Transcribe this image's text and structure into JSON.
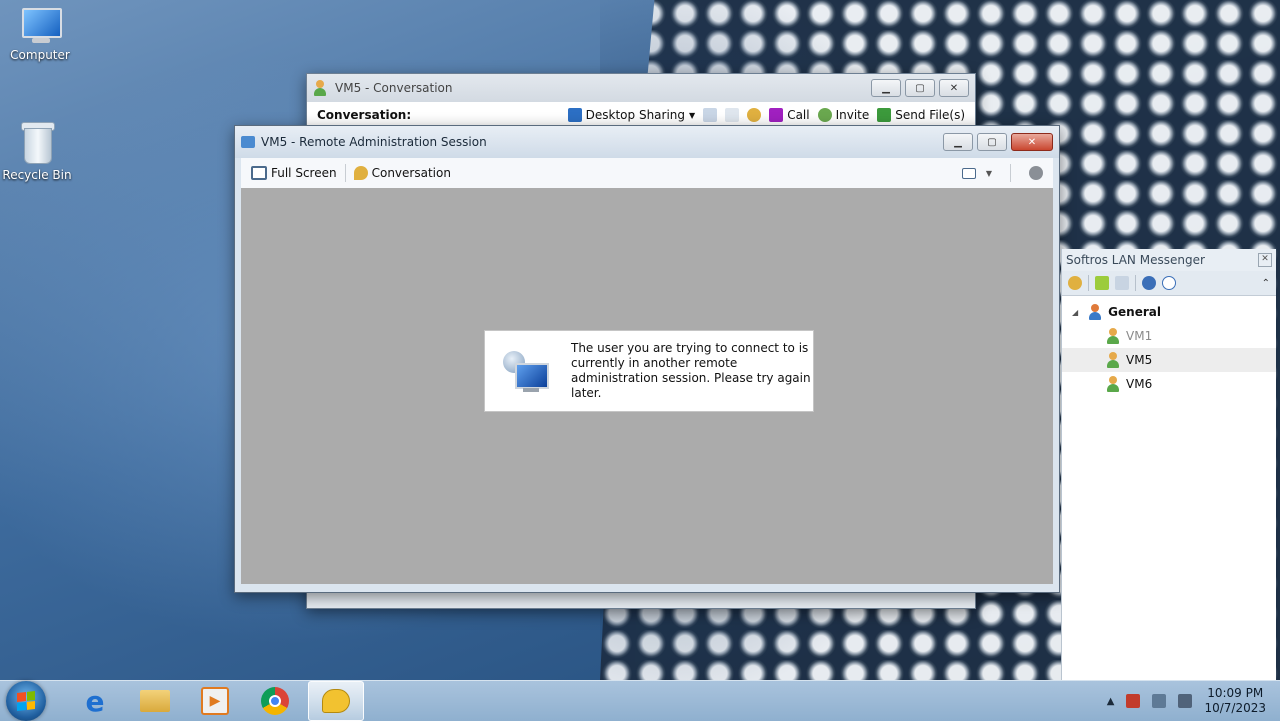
{
  "desktop": {
    "icons": [
      {
        "label": "Computer"
      },
      {
        "label": "Recycle Bin"
      }
    ]
  },
  "conversation_window": {
    "title": "VM5 - Conversation",
    "conversation_label": "Conversation:",
    "desktop_sharing_label": "Desktop Sharing",
    "call_label": "Call",
    "invite_label": "Invite",
    "send_files_label": "Send File(s)"
  },
  "remote_window": {
    "title": "VM5 - Remote Administration Session",
    "full_screen_label": "Full Screen",
    "conversation_label": "Conversation",
    "message": "The user you are trying to connect to is currently in another remote administration session. Please try again later."
  },
  "messenger": {
    "title": "Softros LAN Messenger",
    "group": "General",
    "users": [
      {
        "name": "VM1",
        "status": "offline"
      },
      {
        "name": "VM5",
        "status": "online"
      },
      {
        "name": "VM6",
        "status": "online"
      }
    ],
    "selected_user": "VM5"
  },
  "taskbar": {
    "time": "10:09 PM",
    "date": "10/7/2023"
  },
  "colors": {
    "accent_blue": "#1f5e9e",
    "close_red": "#c9462f",
    "viewport_gray": "#ababab"
  }
}
